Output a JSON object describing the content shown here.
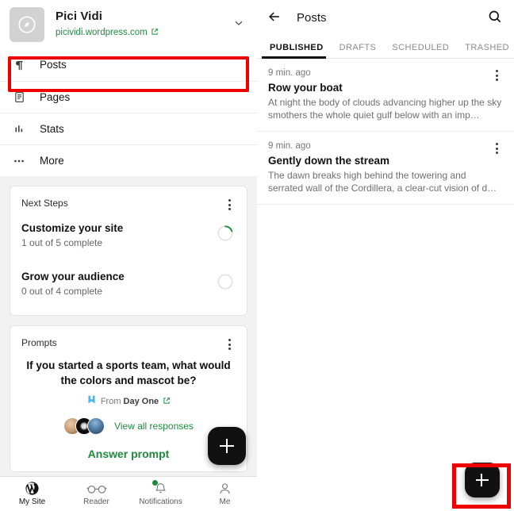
{
  "colors": {
    "accent_green": "#1f8a3d",
    "highlight_red": "#ee0000",
    "fab_black": "#111111",
    "panel_bg": "#f2f2f2"
  },
  "left_panel": {
    "site_header": {
      "title": "Pici Vidi",
      "url": "picividi.wordpress.com",
      "avatar_icon": "compass-icon",
      "external_link_icon": "external-link-icon",
      "chevron_icon": "chevron-down-icon"
    },
    "menu": [
      {
        "label": "Posts",
        "icon": "pilcrow-icon",
        "highlighted": true
      },
      {
        "label": "Pages",
        "icon": "document-icon",
        "highlighted": false
      },
      {
        "label": "Stats",
        "icon": "bar-chart-icon",
        "highlighted": false
      },
      {
        "label": "More",
        "icon": "ellipsis-icon",
        "highlighted": false
      }
    ],
    "next_steps": {
      "card_title": "Next Steps",
      "menu_icon": "kebab-menu-icon",
      "items": [
        {
          "title": "Customize your site",
          "subtitle": "1 out of 5 complete",
          "progress": 20
        },
        {
          "title": "Grow your audience",
          "subtitle": "0 out of 4 complete",
          "progress": 0
        }
      ]
    },
    "prompts": {
      "card_title": "Prompts",
      "menu_icon": "kebab-menu-icon",
      "question": "If you started a sports team, what would the colors and mascot be?",
      "from_prefix": "From",
      "from_source": "Day One",
      "from_icon": "day-one-icon",
      "from_external_icon": "external-link-icon",
      "responses_link": "View all responses",
      "avatar_count": 3,
      "answer_button": "Answer prompt"
    },
    "fab": {
      "icon": "plus-icon",
      "label": "Create"
    },
    "bottom_nav": [
      {
        "label": "My Site",
        "icon": "wordpress-icon",
        "active": true,
        "badge": false
      },
      {
        "label": "Reader",
        "icon": "glasses-icon",
        "active": false,
        "badge": false
      },
      {
        "label": "Notifications",
        "icon": "bell-icon",
        "active": false,
        "badge": true
      },
      {
        "label": "Me",
        "icon": "person-icon",
        "active": false,
        "badge": false
      }
    ]
  },
  "right_panel": {
    "appbar": {
      "back_icon": "back-arrow-icon",
      "title": "Posts",
      "search_icon": "search-icon"
    },
    "tabs": [
      {
        "label": "PUBLISHED",
        "active": true
      },
      {
        "label": "DRAFTS",
        "active": false
      },
      {
        "label": "SCHEDULED",
        "active": false
      },
      {
        "label": "TRASHED",
        "active": false
      }
    ],
    "posts": [
      {
        "time": "9 min. ago",
        "title": "Row your boat",
        "excerpt": "At night the body of clouds advancing higher up the sky smothers the whole quiet gulf below with an imp…",
        "menu_icon": "kebab-menu-icon"
      },
      {
        "time": "9 min. ago",
        "title": "Gently down the stream",
        "excerpt": "The dawn breaks high behind the towering and serrated wall of the Cordillera, a clear-cut vision of d…",
        "menu_icon": "kebab-menu-icon"
      }
    ],
    "fab": {
      "icon": "plus-icon",
      "label": "New post",
      "highlighted": true
    }
  }
}
